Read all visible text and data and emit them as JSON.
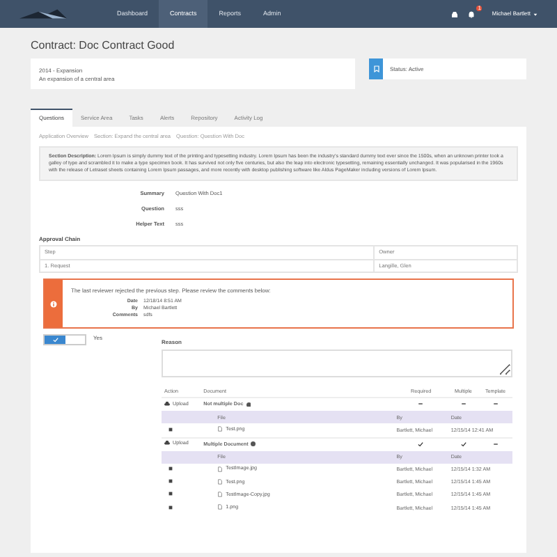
{
  "navbar": {
    "links": [
      {
        "label": "Dashboard",
        "selected": false
      },
      {
        "label": "Contracts",
        "selected": true
      },
      {
        "label": "Reports",
        "selected": false
      },
      {
        "label": "Admin",
        "selected": false
      }
    ],
    "notification_count": "1",
    "user": "Michael Bartlett"
  },
  "title": "Contract: Doc Contract Good",
  "summary": {
    "name": "2014 - Expansion",
    "description": "An expansion of a central area"
  },
  "status": {
    "label": "Status: Active"
  },
  "tabs": [
    {
      "label": "Questions",
      "selected": true
    },
    {
      "label": "Service Area",
      "selected": false
    },
    {
      "label": "Tasks",
      "selected": false
    },
    {
      "label": "Alerts",
      "selected": false
    },
    {
      "label": "Repository",
      "selected": false
    },
    {
      "label": "Activity Log",
      "selected": false
    }
  ],
  "breadcrumb": [
    "Application Overview",
    "Section: Expand the central area",
    "Question: Question With Doc"
  ],
  "section_description": "**Section Description:** Lorem Ipsum is simply dummy text of the printing and typesetting industry. Lorem Ipsum has been the industry's standard dummy text ever since the 1500s, when an unknown printer took a galley of type and scrambled it to make a type specimen book. It has survived not only five centuries, but also the leap into electronic typesetting, remaining essentially unchanged. It was popularised in the 1960s with the release of Letraset sheets containing Lorem Ipsum passages, and more recently with desktop publishing software like Aldus PageMaker including versions of Lorem Ipsum.",
  "details": [
    {
      "label": "Summary",
      "value": "Question With Doc1"
    },
    {
      "label": "Question",
      "value": "sss"
    },
    {
      "label": "Helper Text",
      "value": "sss"
    }
  ],
  "approval_chain": {
    "title": "Approval Chain",
    "columns": [
      "Step",
      "Owner"
    ],
    "rows": [
      [
        "1. Request",
        "Langille, Glen"
      ]
    ]
  },
  "alert": {
    "message": "The last reviewer rejected the previous step. Please review the comments below:",
    "fields": [
      {
        "label": "Date",
        "value": "12/18/14 8:51 AM"
      },
      {
        "label": "By",
        "value": "Michael Bartlett"
      },
      {
        "label": "Comments",
        "value": "sdfs"
      }
    ]
  },
  "answer": {
    "on": true,
    "label": "Yes"
  },
  "reason": {
    "label": "Reason"
  },
  "documents": {
    "columns": [
      "Action",
      "Document",
      "Required",
      "Multiple",
      "Template"
    ],
    "rows": [
      {
        "action": "Upload",
        "name": "Not multiple Doc",
        "required": false,
        "multiple": false,
        "template": false,
        "file_columns": [
          "File",
          "By",
          "Date"
        ],
        "files": [
          {
            "file": "Test.png",
            "by": "Bartlett, Michael",
            "date": "12/15/14 12:41 AM"
          }
        ]
      },
      {
        "action": "Upload",
        "name": "Multiple Document",
        "required": true,
        "multiple": true,
        "template": false,
        "file_columns": [
          "File",
          "By",
          "Date"
        ],
        "files": [
          {
            "file": "TestImage.jpg",
            "by": "Bartlett, Michael",
            "date": "12/15/14 1:32 AM"
          },
          {
            "file": "Test.png",
            "by": "Bartlett, Michael",
            "date": "12/15/14 1:45 AM"
          },
          {
            "file": "TestImage-Copy.jpg",
            "by": "Bartlett, Michael",
            "date": "12/15/14 1:45 AM"
          },
          {
            "file": "1.png",
            "by": "Bartlett, Michael",
            "date": "12/15/14 1:45 AM"
          }
        ]
      }
    ]
  }
}
